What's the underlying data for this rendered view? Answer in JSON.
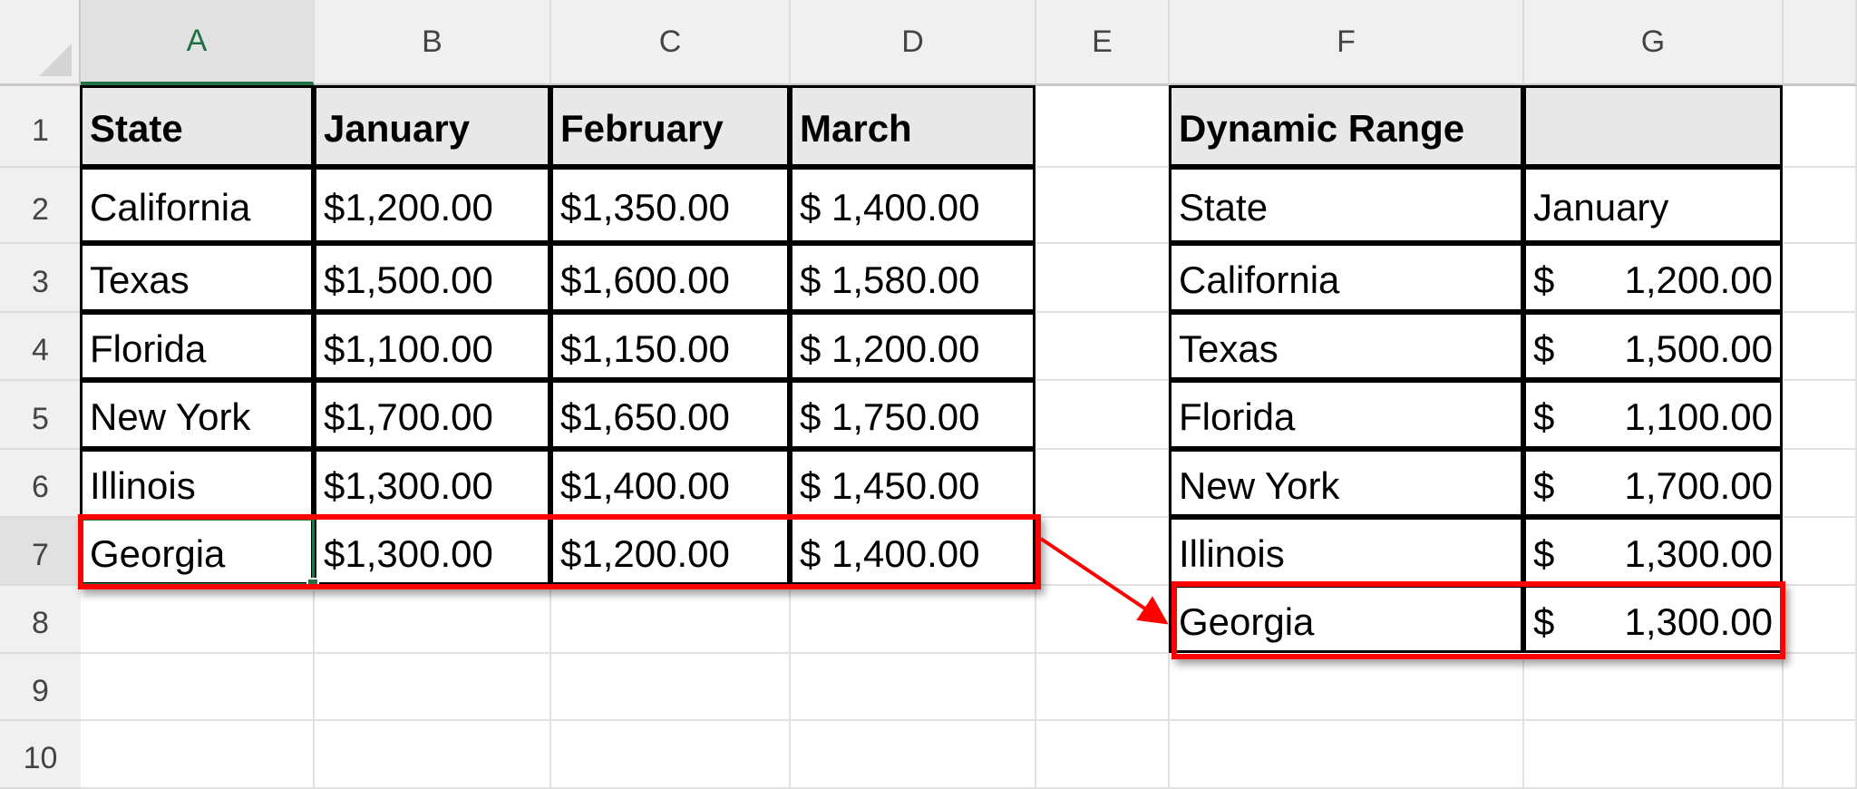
{
  "columns": [
    "A",
    "B",
    "C",
    "D",
    "E",
    "F",
    "G"
  ],
  "rows": [
    "1",
    "2",
    "3",
    "4",
    "5",
    "6",
    "7",
    "8",
    "9",
    "10"
  ],
  "selected_column": "A",
  "selected_row": "7",
  "main_table": {
    "headers": [
      "State",
      "January",
      "February",
      "March"
    ],
    "rows": [
      [
        "California",
        "$1,200.00",
        "$1,350.00",
        "$ 1,400.00"
      ],
      [
        "Texas",
        "$1,500.00",
        "$1,600.00",
        "$ 1,580.00"
      ],
      [
        "Florida",
        "$1,100.00",
        "$1,150.00",
        "$ 1,200.00"
      ],
      [
        "New York",
        "$1,700.00",
        "$1,650.00",
        "$ 1,750.00"
      ],
      [
        "Illinois",
        "$1,300.00",
        "$1,400.00",
        "$ 1,450.00"
      ],
      [
        "Georgia",
        "$1,300.00",
        "$1,200.00",
        "$ 1,400.00"
      ]
    ]
  },
  "dynamic_table": {
    "title": "Dynamic Range",
    "headers": [
      "State",
      "January"
    ],
    "currency_symbol": "$",
    "rows": [
      [
        "California",
        "1,200.00"
      ],
      [
        "Texas",
        "1,500.00"
      ],
      [
        "Florida",
        "1,100.00"
      ],
      [
        "New York",
        "1,700.00"
      ],
      [
        "Illinois",
        "1,300.00"
      ],
      [
        "Georgia",
        "1,300.00"
      ]
    ]
  },
  "colors": {
    "highlight": "#ff0000",
    "selection": "#217346"
  }
}
